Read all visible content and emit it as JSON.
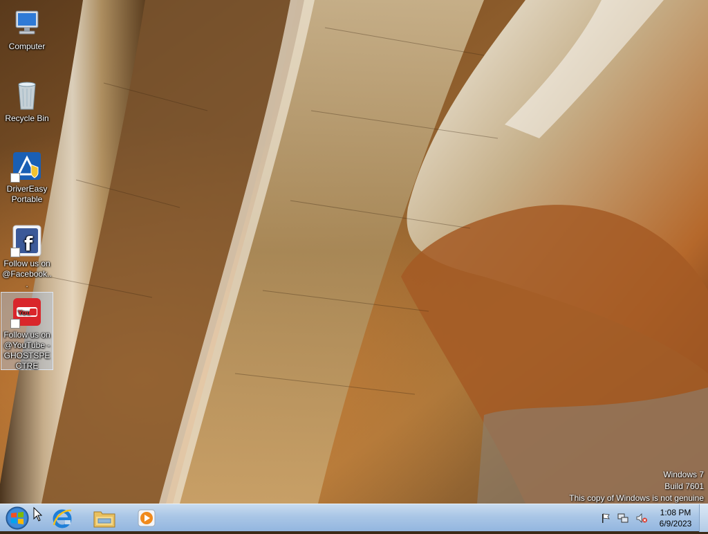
{
  "desktop": {
    "icons": [
      {
        "label": "Computer",
        "icon": "computer-icon"
      },
      {
        "label": "Recycle Bin",
        "icon": "recycle-bin-icon"
      },
      {
        "label": "DriverEasy Portable",
        "icon": "drivereasy-icon"
      },
      {
        "label": "Follow us on @Facebook...",
        "icon": "facebook-icon"
      },
      {
        "label": "Follow us on @YouTube - GHOSTSPECTRE",
        "icon": "youtube-icon"
      }
    ]
  },
  "watermark": {
    "line1": "Windows 7",
    "line2": "Build 7601",
    "line3": "This copy of Windows is not genuine"
  },
  "taskbar": {
    "pinned": [
      "internet-explorer-icon",
      "windows-explorer-icon",
      "windows-media-player-icon"
    ],
    "tray_icons": [
      "action-center-flag-icon",
      "network-icon",
      "volume-muted-icon"
    ],
    "clock": {
      "time": "1:08 PM",
      "date": "6/9/2023"
    }
  },
  "colors": {
    "taskbar_top": "#c9dcef",
    "taskbar_bottom": "#93b6df",
    "youtube_red": "#d9262b",
    "facebook_blue": "#3b5998"
  }
}
